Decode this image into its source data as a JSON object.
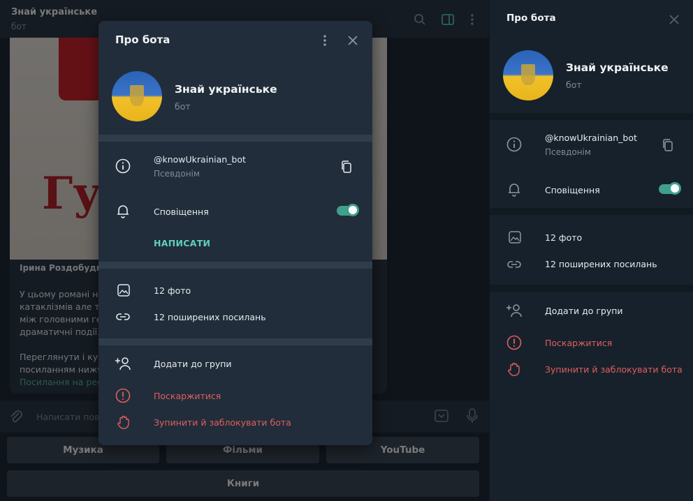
{
  "chat": {
    "title": "Знай українське",
    "subtitle": "бот",
    "message": {
      "author": "Ірина Роздобудь",
      "image_title": "Гуд",
      "lines": [
        "У цьому романі не",
        "катаклізмів але тр",
        "між головними ге",
        "драматичні події.",
        "",
        "Переглянути і куп",
        "посиланням нижч"
      ],
      "link": "Посилання на рес"
    },
    "composer_placeholder": "Написати пов",
    "keyboard": {
      "music": "Музика",
      "films": "Фільми",
      "youtube": "YouTube",
      "books": "Книги"
    }
  },
  "modal": {
    "title": "Про бота",
    "bot_name": "Знай українське",
    "bot_type": "бот",
    "username": "@knowUkrainian_bot",
    "username_caption": "Псевдонім",
    "notifications_label": "Сповіщення",
    "notifications_on": true,
    "write_button": "НАПИСАТИ",
    "photos": "12 фото",
    "links": "12 поширених посилань",
    "add_to_group": "Додати до групи",
    "report": "Поскаржитися",
    "block": "Зупинити й заблокувати бота"
  },
  "side": {
    "title": "Про бота",
    "bot_name": "Знай українське",
    "bot_type": "бот",
    "username": "@knowUkrainian_bot",
    "username_caption": "Псевдонім",
    "notifications_label": "Сповіщення",
    "photos": "12 фото",
    "links": "12 поширених посилань",
    "add_to_group": "Додати до групи",
    "report": "Поскаржитися",
    "block": "Зупинити й заблокувати бота"
  },
  "colors": {
    "accent": "#3fa08c",
    "danger": "#e05f5f",
    "bg": "#17212b"
  },
  "icons": [
    "search-icon",
    "sidebar-toggle-icon",
    "more-vertical-icon",
    "close-icon",
    "info-icon",
    "copy-icon",
    "bell-icon",
    "photo-icon",
    "link-icon",
    "add-user-icon",
    "report-icon",
    "hand-stop-icon",
    "attach-icon",
    "keyboard-icon",
    "microphone-icon"
  ]
}
